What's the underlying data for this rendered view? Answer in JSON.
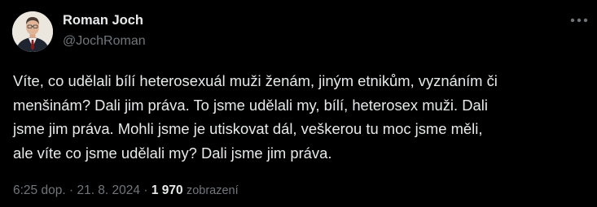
{
  "author": {
    "name": "Roman Joch",
    "handle": "@JochRoman"
  },
  "tweet": {
    "lines": [
      "Víte, co udělali bílí heterosexuál muži ženám, jiným etnikům, vyznáním či",
      "menšinám? Dali jim práva. To jsme udělali my, bílí, heterosex muži. Dali",
      "jsme jim práva. Mohli jsme je utiskovat dál, veškerou tu moc jsme měli,",
      "ale víte co jsme udělali my? Dali jsme jim práva."
    ]
  },
  "meta": {
    "time": "6:25 dop.",
    "separator": "·",
    "date": "21. 8. 2024",
    "views_count": "1 970",
    "views_label": "zobrazení"
  },
  "colors": {
    "background": "#000000",
    "text_primary": "#e7e9ea",
    "text_secondary": "#71767b"
  },
  "icons": {
    "more": "more-horizontal-icon",
    "avatar": "profile-photo"
  }
}
